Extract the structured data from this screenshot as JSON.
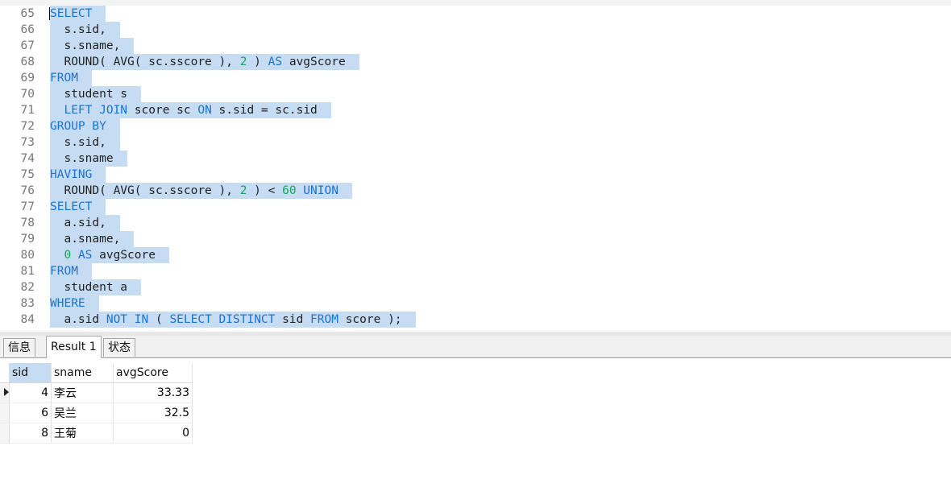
{
  "editor": {
    "lines": [
      {
        "n": "65",
        "tokens": [
          {
            "t": "SELECT",
            "c": "kw"
          }
        ]
      },
      {
        "n": "66",
        "tokens": [
          {
            "t": "  s.sid,",
            "c": "txt"
          }
        ]
      },
      {
        "n": "67",
        "tokens": [
          {
            "t": "  s.sname,",
            "c": "txt"
          }
        ]
      },
      {
        "n": "68",
        "tokens": [
          {
            "t": "  ROUND( AVG( sc.sscore ), ",
            "c": "txt"
          },
          {
            "t": "2",
            "c": "num"
          },
          {
            "t": " ) ",
            "c": "txt"
          },
          {
            "t": "AS",
            "c": "kw"
          },
          {
            "t": " avgScore",
            "c": "txt"
          }
        ]
      },
      {
        "n": "69",
        "tokens": [
          {
            "t": "FROM",
            "c": "kw"
          }
        ]
      },
      {
        "n": "70",
        "tokens": [
          {
            "t": "  student s",
            "c": "txt"
          }
        ]
      },
      {
        "n": "71",
        "tokens": [
          {
            "t": "  ",
            "c": "txt"
          },
          {
            "t": "LEFT JOIN",
            "c": "kw"
          },
          {
            "t": " score sc ",
            "c": "txt"
          },
          {
            "t": "ON",
            "c": "kw"
          },
          {
            "t": " s.sid = sc.sid",
            "c": "txt"
          }
        ]
      },
      {
        "n": "72",
        "tokens": [
          {
            "t": "GROUP BY",
            "c": "kw"
          }
        ]
      },
      {
        "n": "73",
        "tokens": [
          {
            "t": "  s.sid,",
            "c": "txt"
          }
        ]
      },
      {
        "n": "74",
        "tokens": [
          {
            "t": "  s.sname",
            "c": "txt"
          }
        ]
      },
      {
        "n": "75",
        "tokens": [
          {
            "t": "HAVING",
            "c": "kw"
          }
        ]
      },
      {
        "n": "76",
        "tokens": [
          {
            "t": "  ROUND( AVG( sc.sscore ), ",
            "c": "txt"
          },
          {
            "t": "2",
            "c": "num"
          },
          {
            "t": " ) < ",
            "c": "txt"
          },
          {
            "t": "60",
            "c": "num"
          },
          {
            "t": " ",
            "c": "txt"
          },
          {
            "t": "UNION",
            "c": "kw"
          }
        ]
      },
      {
        "n": "77",
        "tokens": [
          {
            "t": "SELECT",
            "c": "kw"
          }
        ]
      },
      {
        "n": "78",
        "tokens": [
          {
            "t": "  a.sid,",
            "c": "txt"
          }
        ]
      },
      {
        "n": "79",
        "tokens": [
          {
            "t": "  a.sname,",
            "c": "txt"
          }
        ]
      },
      {
        "n": "80",
        "tokens": [
          {
            "t": "  ",
            "c": "txt"
          },
          {
            "t": "0",
            "c": "num"
          },
          {
            "t": " ",
            "c": "txt"
          },
          {
            "t": "AS",
            "c": "kw"
          },
          {
            "t": " avgScore",
            "c": "txt"
          }
        ]
      },
      {
        "n": "81",
        "tokens": [
          {
            "t": "FROM",
            "c": "kw"
          }
        ]
      },
      {
        "n": "82",
        "tokens": [
          {
            "t": "  student a",
            "c": "txt"
          }
        ]
      },
      {
        "n": "83",
        "tokens": [
          {
            "t": "WHERE",
            "c": "kw"
          }
        ]
      },
      {
        "n": "84",
        "tokens": [
          {
            "t": "  a.sid ",
            "c": "txt"
          },
          {
            "t": "NOT IN",
            "c": "kw"
          },
          {
            "t": " ( ",
            "c": "txt"
          },
          {
            "t": "SELECT DISTINCT",
            "c": "kw"
          },
          {
            "t": " sid ",
            "c": "txt"
          },
          {
            "t": "FROM",
            "c": "kw"
          },
          {
            "t": " score );",
            "c": "txt"
          }
        ]
      }
    ]
  },
  "tabs": [
    {
      "label": "信息",
      "active": false
    },
    {
      "label": "Result 1",
      "active": true
    },
    {
      "label": "状态",
      "active": false
    }
  ],
  "result": {
    "columns": [
      "sid",
      "sname",
      "avgScore"
    ],
    "rows": [
      {
        "sid": "4",
        "sname": "李云",
        "avgScore": "33.33"
      },
      {
        "sid": "6",
        "sname": "吴兰",
        "avgScore": "32.5"
      },
      {
        "sid": "8",
        "sname": "王菊",
        "avgScore": "0"
      }
    ]
  },
  "icons": {
    "current_row": "current-row-arrow-icon"
  },
  "colors": {
    "keyword": "#1874d2",
    "number": "#12a85a",
    "selection": "#c5dcf3"
  }
}
